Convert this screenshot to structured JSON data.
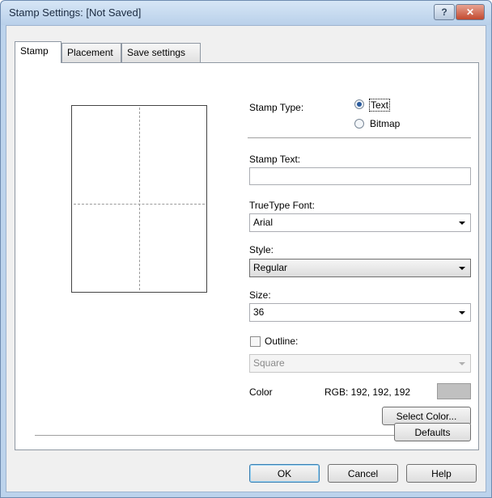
{
  "window": {
    "title": "Stamp Settings: [Not Saved]",
    "help_glyph": "?",
    "close_glyph": "✕"
  },
  "tabs": [
    {
      "label": "Stamp",
      "active": true
    },
    {
      "label": "Placement",
      "active": false
    },
    {
      "label": "Save settings",
      "active": false
    }
  ],
  "stamp_type": {
    "label": "Stamp Type:",
    "options": [
      {
        "label": "Text",
        "selected": true
      },
      {
        "label": "Bitmap",
        "selected": false
      }
    ]
  },
  "stamp_text": {
    "label": "Stamp Text:",
    "value": ""
  },
  "font": {
    "label": "TrueType Font:",
    "value": "Arial"
  },
  "style": {
    "label": "Style:",
    "value": "Regular"
  },
  "size": {
    "label": "Size:",
    "value": "36"
  },
  "outline": {
    "label": "Outline:",
    "checked": false,
    "value": "Square"
  },
  "color": {
    "label": "Color",
    "rgb_text": "RGB: 192, 192, 192",
    "swatch": "#c0c0c0"
  },
  "buttons": {
    "select_color": "Select Color...",
    "defaults": "Defaults",
    "ok": "OK",
    "cancel": "Cancel",
    "help": "Help"
  }
}
